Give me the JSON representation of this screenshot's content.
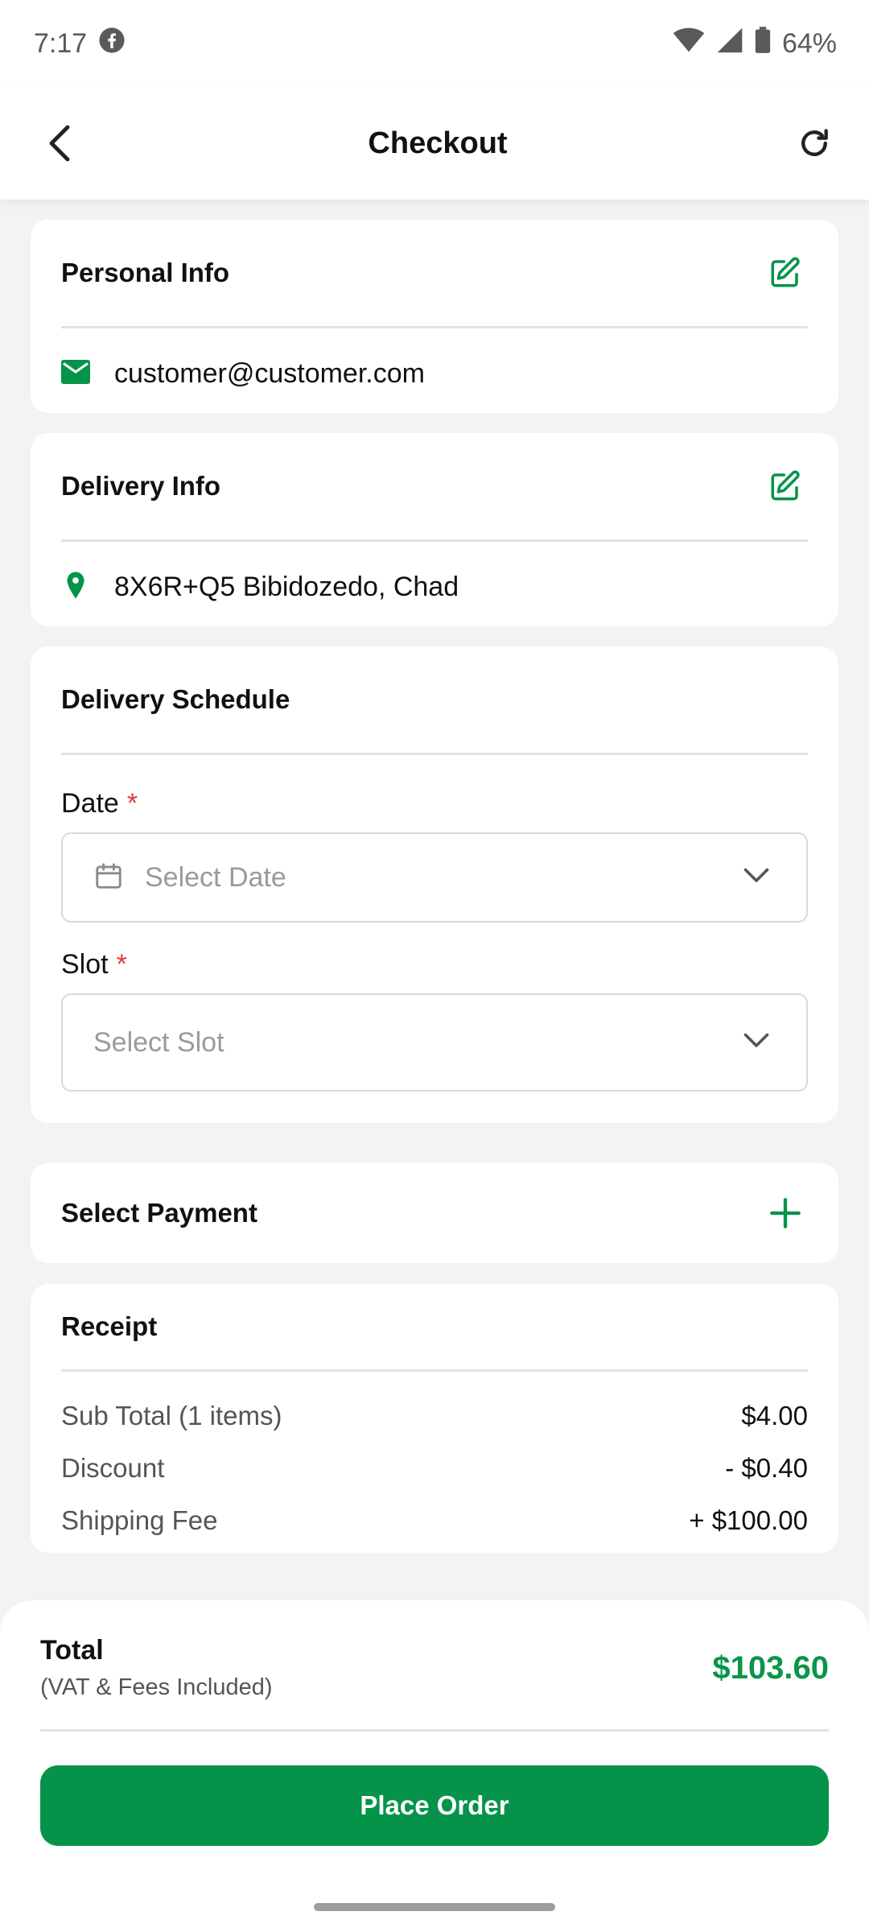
{
  "status_bar": {
    "time": "7:17",
    "battery": "64%"
  },
  "app_bar": {
    "title": "Checkout"
  },
  "personal_info": {
    "title": "Personal Info",
    "email": "customer@customer.com"
  },
  "delivery_info": {
    "title": "Delivery Info",
    "address": "8X6R+Q5 Bibidozedo, Chad"
  },
  "delivery_schedule": {
    "title": "Delivery Schedule",
    "date_label": "Date",
    "date_placeholder": "Select Date",
    "slot_label": "Slot",
    "slot_placeholder": "Select Slot",
    "required_mark": "*"
  },
  "payment": {
    "title": "Select Payment"
  },
  "receipt": {
    "title": "Receipt",
    "rows": [
      {
        "label": "Sub Total (1 items)",
        "value": "$4.00"
      },
      {
        "label": "Discount",
        "value": "- $0.40"
      },
      {
        "label": "Shipping Fee",
        "value": "+ $100.00"
      }
    ]
  },
  "total": {
    "label": "Total",
    "sub": "(VAT & Fees Included)",
    "value": "$103.60"
  },
  "place_order": {
    "label": "Place Order"
  },
  "colors": {
    "accent": "#05934a",
    "required": "#e53935"
  }
}
